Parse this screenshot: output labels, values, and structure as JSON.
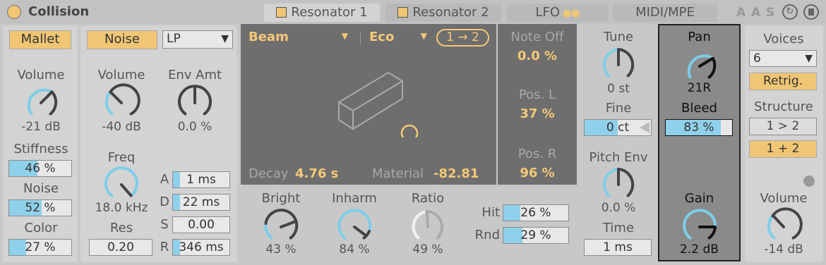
{
  "header": {
    "title": "Collision",
    "tabs": [
      {
        "label": "Resonator 1",
        "active": true
      },
      {
        "label": "Resonator 2",
        "active": false
      },
      {
        "label": "LFO",
        "active": false
      },
      {
        "label": "MIDI/MPE",
        "active": false
      }
    ],
    "icons": [
      "letter-a-icon",
      "letter-a-icon",
      "letter-s-icon",
      "refresh-icon",
      "save-icon"
    ]
  },
  "mallet": {
    "button": "Mallet",
    "volume_label": "Volume",
    "volume_value": "-21 dB",
    "stiffness_label": "Stiffness",
    "stiffness_value": "46 %",
    "stiffness_fill": 0.46,
    "noise_label": "Noise",
    "noise_value": "52 %",
    "noise_fill": 0.52,
    "color_label": "Color",
    "color_value": "27 %",
    "color_fill": 0.27
  },
  "noise": {
    "button": "Noise",
    "filter": "LP",
    "volume_label": "Volume",
    "volume_value": "-40 dB",
    "env_amt_label": "Env Amt",
    "env_amt_value": "0.0 %",
    "freq_label": "Freq",
    "freq_value": "18.0 kHz",
    "res_label": "Res",
    "res_value": "0.20",
    "adsr": [
      {
        "label": "A",
        "value": "1 ms",
        "fill": 0.12
      },
      {
        "label": "D",
        "value": "22 ms",
        "fill": 0.12
      },
      {
        "label": "S",
        "value": "0.00",
        "fill": 0
      },
      {
        "label": "R",
        "value": "346 ms",
        "fill": 0.12
      }
    ]
  },
  "resonator": {
    "type": "Beam",
    "quality": "Eco",
    "routing": "1 → 2",
    "decay_label": "Decay",
    "decay_value": "4.76 s",
    "material_label": "Material",
    "material_value": "-82.81",
    "note_off_label": "Note Off",
    "note_off_value": "0.0 %",
    "pos_l_label": "Pos. L",
    "pos_l_value": "37 %",
    "pos_r_label": "Pos. R",
    "pos_r_value": "96 %",
    "bright_label": "Bright",
    "bright_value": "43 %",
    "inharm_label": "Inharm",
    "inharm_value": "84 %",
    "ratio_label": "Ratio",
    "ratio_value": "49 %",
    "hit_label": "Hit",
    "hit_value": "26 %",
    "hit_fill": 0.26,
    "rnd_label": "Rnd",
    "rnd_value": "29 %",
    "rnd_fill": 0.29,
    "tune_label": "Tune",
    "tune_value": "0 st",
    "fine_label": "Fine",
    "fine_value": "0 ct",
    "pitch_env_label": "Pitch Env",
    "pitch_env_value": "0.0 %",
    "time_label": "Time",
    "time_value": "1 ms",
    "pan_label": "Pan",
    "pan_value": "21R",
    "bleed_label": "Bleed",
    "bleed_value": "83 %",
    "bleed_fill": 0.83,
    "gain_label": "Gain",
    "gain_value": "2.2 dB"
  },
  "global": {
    "voices_label": "Voices",
    "voices_value": "6",
    "retrig": "Retrig.",
    "structure_label": "Structure",
    "structure_a": "1 > 2",
    "structure_b": "1 + 2",
    "volume_label": "Volume",
    "volume_value": "-14 dB"
  },
  "colors": {
    "accent": "#f0c674",
    "meter": "#8fd0ea",
    "arc": "#7ecde8",
    "dark_panel": "#6e6e6e",
    "orange_text": "#f4c878"
  }
}
